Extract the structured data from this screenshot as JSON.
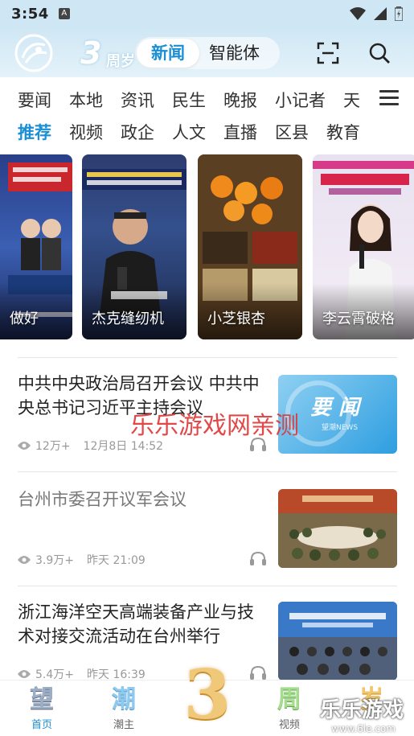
{
  "status_bar": {
    "time": "3:54",
    "notification_letter": "A"
  },
  "header": {
    "anniversary_number": "3",
    "anniversary_text": "周岁",
    "segment_tabs": [
      "新闻",
      "智能体"
    ]
  },
  "category_tabs_row1": [
    "要闻",
    "本地",
    "资讯",
    "民生",
    "晚报",
    "小记者",
    "天"
  ],
  "category_tabs_row2": [
    "推荐",
    "视频",
    "政企",
    "人文",
    "直播",
    "区县",
    "教育"
  ],
  "video_cards": [
    {
      "caption": "做好"
    },
    {
      "caption": "杰克缝纫机"
    },
    {
      "caption": "小芝银杏"
    },
    {
      "caption": "李云霄破格"
    }
  ],
  "news": [
    {
      "title": "中共中央政治局召开会议 中共中央总书记习近平主持会议",
      "views": "12万+",
      "time": "12月8日 14:52",
      "thumb_title": "要 闻",
      "thumb_sub": "望潮NEWS"
    },
    {
      "title": "台州市委召开议军会议",
      "views": "3.9万+",
      "time": "昨天 21:09"
    },
    {
      "title": "浙江海洋空天高端装备产业与技术对接交流活动在台州举行",
      "views": "5.4万+",
      "time": "昨天 16:39"
    }
  ],
  "watermark": "乐乐游戏网亲测",
  "bottom_nav": [
    {
      "glyph": "望",
      "label": "首页"
    },
    {
      "glyph": "潮",
      "label": "潮主"
    },
    {
      "glyph": "3",
      "label": ""
    },
    {
      "glyph": "周",
      "label": "视频"
    },
    {
      "glyph": "岁",
      "label": ""
    }
  ],
  "corner_watermark": {
    "text": "乐乐游戏",
    "url": "www.6le.com"
  },
  "colors": {
    "accent": "#1a8fd6",
    "header_bg": "#cfe7f4",
    "gold": "#f0c87a"
  }
}
